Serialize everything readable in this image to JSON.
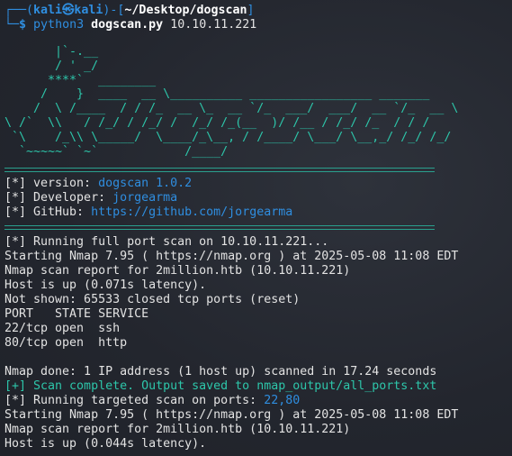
{
  "prompt": {
    "corner_top": "┌──(",
    "user": "kali",
    "at": "㉿",
    "host": "kali",
    "mid": ")-[",
    "path": "~/Desktop/dogscan",
    "close": "]",
    "corner_bottom": "└─",
    "dollar": "$",
    "command": "python3",
    "script": "dogscan.py",
    "args": "10.10.11.221"
  },
  "banner_art": "       |`-.__\n       / ' _/\n      ****`  ________\n     /    }  ____  __ \\__________ _________________ _______\n    /  \\ /____  / / /_  __ \\_  __ `/_  ___/  ___/  __ `/_  __ \\\n\\ /`  \\\\   / /_/ / /_/ /  /_/ /_(__  )/ /__ / /_/ /_  / / /\n `\\    /_\\\\ \\_____/  \\____/_\\__, / /____/ \\___/ \\__,_/ /_/ /_/\n  `~~~~~` `~`            /____/",
  "info": [
    {
      "prefix": "[*] version: ",
      "value": "dogscan 1.0.2"
    },
    {
      "prefix": "[*] Developer: ",
      "value": "jorgearma"
    },
    {
      "prefix": "[*] GitHub: ",
      "value": "https://github.com/jorgearma"
    }
  ],
  "output": {
    "running_full": "[*] Running full port scan on 10.10.11.221...",
    "starting1": "Starting Nmap 7.95 ( https://nmap.org ) at 2025-05-08 11:08 EDT",
    "report1": "Nmap scan report for 2million.htb (10.10.11.221)",
    "hostup1": "Host is up (0.071s latency).",
    "notshown": "Not shown: 65533 closed tcp ports (reset)",
    "header": "PORT   STATE SERVICE",
    "port22": "22/tcp open  ssh",
    "port80": "80/tcp open  http",
    "done": "Nmap done: 1 IP address (1 host up) scanned in 17.24 seconds",
    "complete": "[+] Scan complete. Output saved to nmap_output/all_ports.txt",
    "targeted_prefix": "[*] Running targeted scan on ports: ",
    "targeted_ports": "22,80",
    "starting2": "Starting Nmap 7.95 ( https://nmap.org ) at 2025-05-08 11:08 EDT",
    "report2": "Nmap scan report for 2million.htb (10.10.11.221)",
    "hostup2": "Host is up (0.044s latency)."
  }
}
